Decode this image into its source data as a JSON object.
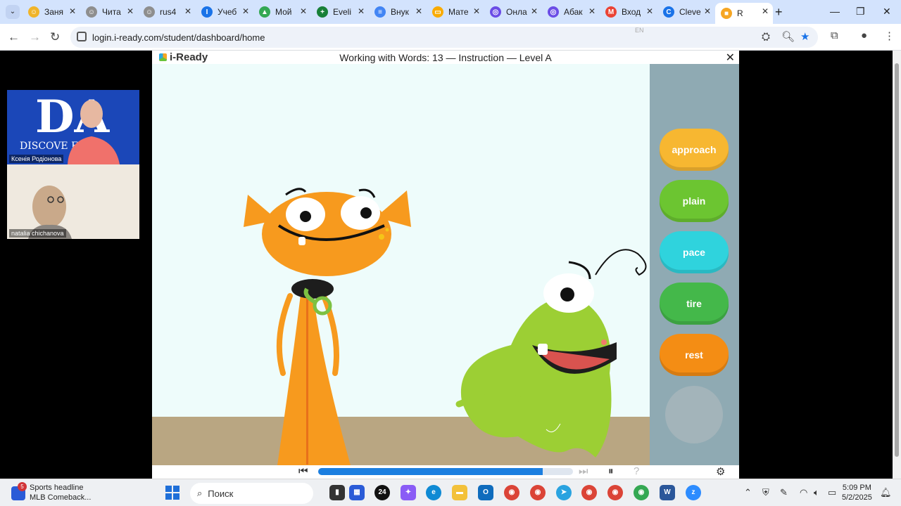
{
  "browser": {
    "tabs": [
      {
        "label": "Заня",
        "color": "#f0b429",
        "glyph": "☺"
      },
      {
        "label": "Чита",
        "color": "#8e8e8e",
        "glyph": "☺"
      },
      {
        "label": "rus4",
        "color": "#8e8e8e",
        "glyph": "☺"
      },
      {
        "label": "Учеб",
        "color": "#1a73e8",
        "glyph": "I"
      },
      {
        "label": "Мой",
        "color": "#34a853",
        "glyph": "▲"
      },
      {
        "label": "Eveli",
        "color": "#188038",
        "glyph": "+"
      },
      {
        "label": "Внук",
        "color": "#4285f4",
        "glyph": "≡"
      },
      {
        "label": "Мате",
        "color": "#f9ab00",
        "glyph": "▭"
      },
      {
        "label": "Онла",
        "color": "#6b4de6",
        "glyph": "◎"
      },
      {
        "label": "Абак",
        "color": "#6b4de6",
        "glyph": "◎"
      },
      {
        "label": "Вход",
        "color": "#ea4335",
        "glyph": "M"
      },
      {
        "label": "Cleve",
        "color": "#1a73e8",
        "glyph": "C"
      },
      {
        "label": "R",
        "color": "#f6a623",
        "glyph": "■",
        "active": true
      }
    ],
    "url": "login.i-ready.com/student/dashboard/home",
    "lang_hint": "EN"
  },
  "zoom": {
    "participants": [
      {
        "name": "Ксенія Родіонова"
      },
      {
        "name": "natalia chichanova"
      }
    ]
  },
  "iready": {
    "logo": "i-Ready",
    "title": "Working with Words: 13 — Instruction — Level A",
    "words": [
      {
        "label": "approach",
        "color": "#f7b731"
      },
      {
        "label": "plain",
        "color": "#6cc531"
      },
      {
        "label": "pace",
        "color": "#2fd3dd"
      },
      {
        "label": "tire",
        "color": "#44b84a"
      },
      {
        "label": "rest",
        "color": "#f48d14"
      }
    ],
    "progress_fraction": 0.88
  },
  "taskbar": {
    "news_title": "Sports headline",
    "news_sub": "MLB Comeback...",
    "news_badge": "5",
    "search_placeholder": "Поиск",
    "time": "5:09 PM",
    "date": "5/2/2025"
  }
}
